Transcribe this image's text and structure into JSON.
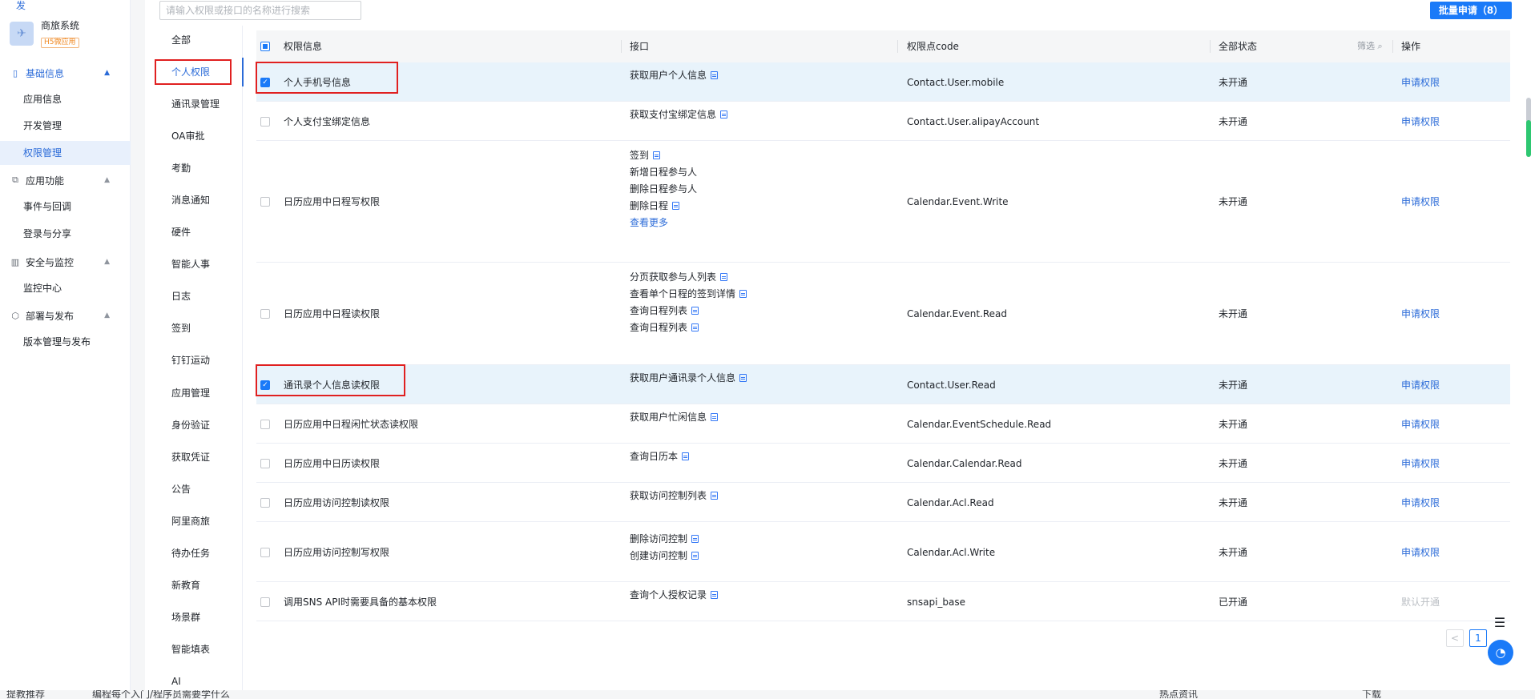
{
  "sidebar": {
    "top_cut_text": "发",
    "app_name": "商旅系统",
    "app_tag": "H5微应用",
    "groups": [
      {
        "label": "基础信息",
        "icon": "doc-icon"
      },
      {
        "label": "应用功能",
        "icon": "plugin-icon"
      },
      {
        "label": "安全与监控",
        "icon": "bar-chart-icon"
      },
      {
        "label": "部署与发布",
        "icon": "box-icon"
      }
    ],
    "items": [
      "应用信息",
      "开发管理",
      "权限管理",
      "事件与回调",
      "登录与分享",
      "监控中心",
      "版本管理与发布"
    ]
  },
  "search": {
    "placeholder": "请输入权限或接口的名称进行搜索"
  },
  "batch_button": "批量申请（8）",
  "categories": [
    "全部",
    "个人权限",
    "通讯录管理",
    "OA审批",
    "考勤",
    "消息通知",
    "硬件",
    "智能人事",
    "日志",
    "签到",
    "钉钉运动",
    "应用管理",
    "身份验证",
    "获取凭证",
    "公告",
    "阿里商旅",
    "待办任务",
    "新教育",
    "场景群",
    "智能填表",
    "AI"
  ],
  "table": {
    "headers": [
      "权限信息",
      "接口",
      "权限点code",
      "全部状态",
      "操作"
    ],
    "filter_label": "筛选",
    "rows": [
      {
        "name": "个人手机号信息",
        "apis": [
          "获取用户个人信息"
        ],
        "code": "Contact.User.mobile",
        "status": "未开通",
        "action": "申请权限",
        "checked": true
      },
      {
        "name": "个人支付宝绑定信息",
        "apis": [
          "获取支付宝绑定信息"
        ],
        "code": "Contact.User.alipayAccount",
        "status": "未开通",
        "action": "申请权限",
        "checked": false
      },
      {
        "name": "日历应用中日程写权限",
        "apis": [
          "签到",
          "新增日程参与人",
          "删除日程参与人",
          "删除日程"
        ],
        "more": "查看更多",
        "code": "Calendar.Event.Write",
        "status": "未开通",
        "action": "申请权限",
        "checked": false
      },
      {
        "name": "日历应用中日程读权限",
        "apis": [
          "分页获取参与人列表",
          "查看单个日程的签到详情",
          "查询日程列表",
          "查询日程列表"
        ],
        "code": "Calendar.Event.Read",
        "status": "未开通",
        "action": "申请权限",
        "checked": false
      },
      {
        "name": "通讯录个人信息读权限",
        "apis": [
          "获取用户通讯录个人信息"
        ],
        "code": "Contact.User.Read",
        "status": "未开通",
        "action": "申请权限",
        "checked": true
      },
      {
        "name": "日历应用中日程闲忙状态读权限",
        "apis": [
          "获取用户忙闲信息"
        ],
        "code": "Calendar.EventSchedule.Read",
        "status": "未开通",
        "action": "申请权限",
        "checked": false
      },
      {
        "name": "日历应用中日历读权限",
        "apis": [
          "查询日历本"
        ],
        "code": "Calendar.Calendar.Read",
        "status": "未开通",
        "action": "申请权限",
        "checked": false
      },
      {
        "name": "日历应用访问控制读权限",
        "apis": [
          "获取访问控制列表"
        ],
        "code": "Calendar.Acl.Read",
        "status": "未开通",
        "action": "申请权限",
        "checked": false
      },
      {
        "name": "日历应用访问控制写权限",
        "apis": [
          "删除访问控制",
          "创建访问控制"
        ],
        "code": "Calendar.Acl.Write",
        "status": "未开通",
        "action": "申请权限",
        "checked": false
      },
      {
        "name": "调用SNS API时需要具备的基本权限",
        "apis": [
          "查询个人授权记录"
        ],
        "code": "snsapi_base",
        "status": "已开通",
        "action": "默认开通",
        "checked": false
      }
    ]
  },
  "pagination": {
    "prev": "<",
    "current": "1"
  },
  "bottom_bar": {
    "left": "提教推荐",
    "middle": "编程每个入门/程序员需要学什么",
    "right": "热点资讯",
    "far_right": "下载"
  }
}
